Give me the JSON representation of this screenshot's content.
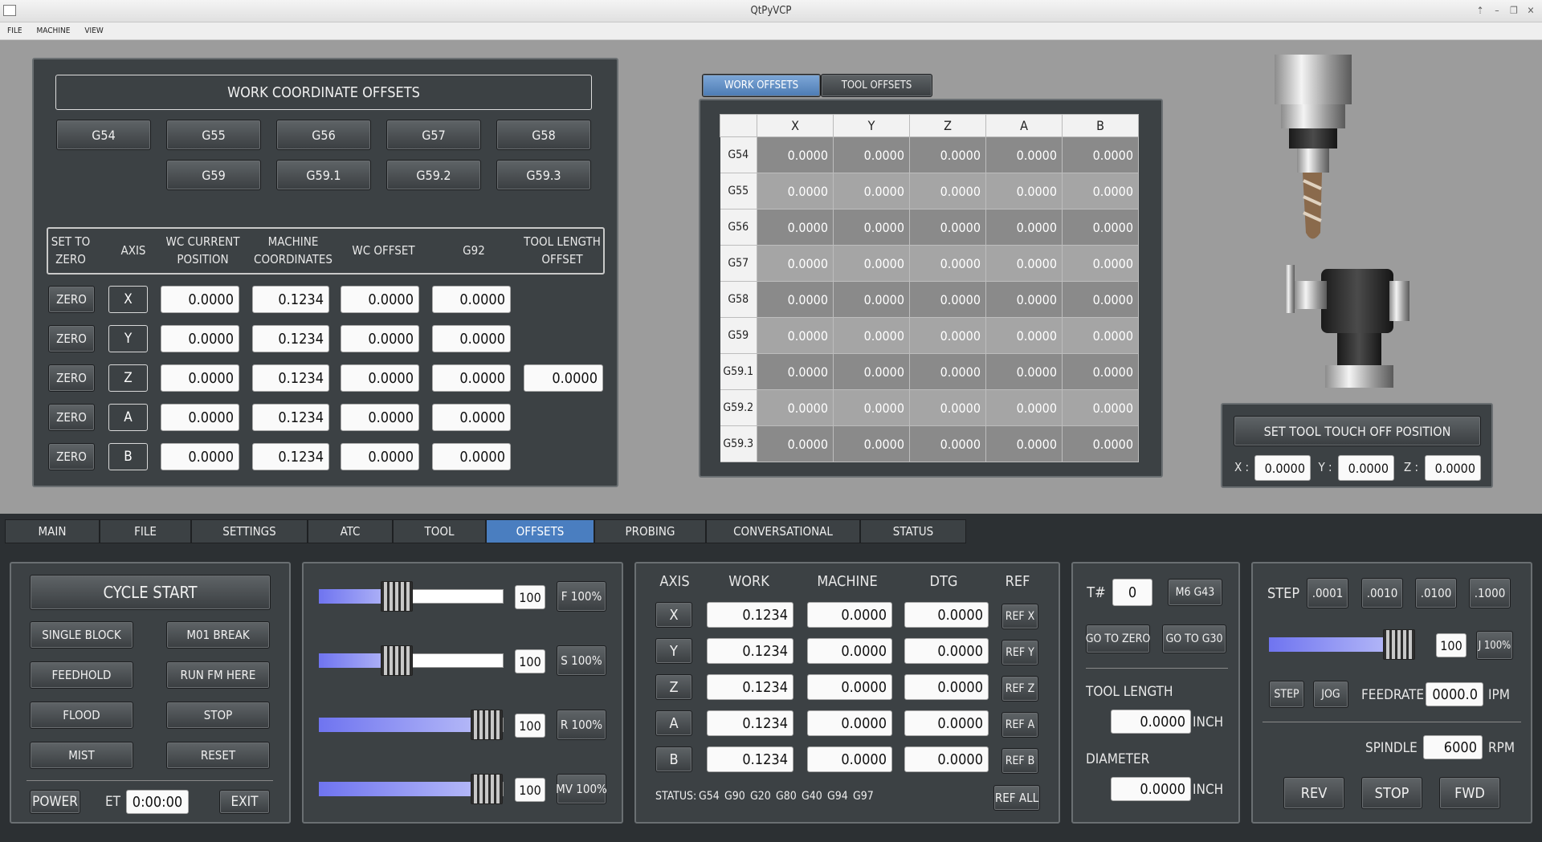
{
  "window": {
    "title": "QtPyVCP",
    "controls": [
      "⇡",
      "–",
      "❐",
      "✕"
    ]
  },
  "menu": [
    "FILE",
    "MACHINE",
    "VIEW"
  ],
  "wco": {
    "title": "WORK COORDINATE OFFSETS",
    "row1": [
      "G54",
      "G55",
      "G56",
      "G57",
      "G58"
    ],
    "row2": [
      "G59",
      "G59.1",
      "G59.2",
      "G59.3"
    ],
    "headers": [
      "SET TO\nZERO",
      "AXIS",
      "WC CURRENT\nPOSITION",
      "MACHINE\nCOORDINATES",
      "WC OFFSET",
      "G92",
      "TOOL LENGTH\nOFFSET"
    ],
    "zero_label": "ZERO",
    "rows": [
      {
        "axis": "X",
        "wc": "0.0000",
        "mach": "0.1234",
        "off": "0.0000",
        "g92": "0.0000"
      },
      {
        "axis": "Y",
        "wc": "0.0000",
        "mach": "0.1234",
        "off": "0.0000",
        "g92": "0.0000"
      },
      {
        "axis": "Z",
        "wc": "0.0000",
        "mach": "0.1234",
        "off": "0.0000",
        "g92": "0.0000",
        "tlo": "0.0000"
      },
      {
        "axis": "A",
        "wc": "0.0000",
        "mach": "0.1234",
        "off": "0.0000",
        "g92": "0.0000"
      },
      {
        "axis": "B",
        "wc": "0.0000",
        "mach": "0.1234",
        "off": "0.0000",
        "g92": "0.0000"
      }
    ]
  },
  "offset_tabs": [
    "WORK OFFSETS",
    "TOOL OFFSETS"
  ],
  "offset_table": {
    "columns": [
      "X",
      "Y",
      "Z",
      "A",
      "B"
    ],
    "rows": [
      {
        "name": "G54",
        "vals": [
          "0.0000",
          "0.0000",
          "0.0000",
          "0.0000",
          "0.0000"
        ]
      },
      {
        "name": "G55",
        "vals": [
          "0.0000",
          "0.0000",
          "0.0000",
          "0.0000",
          "0.0000"
        ]
      },
      {
        "name": "G56",
        "vals": [
          "0.0000",
          "0.0000",
          "0.0000",
          "0.0000",
          "0.0000"
        ]
      },
      {
        "name": "G57",
        "vals": [
          "0.0000",
          "0.0000",
          "0.0000",
          "0.0000",
          "0.0000"
        ]
      },
      {
        "name": "G58",
        "vals": [
          "0.0000",
          "0.0000",
          "0.0000",
          "0.0000",
          "0.0000"
        ]
      },
      {
        "name": "G59",
        "vals": [
          "0.0000",
          "0.0000",
          "0.0000",
          "0.0000",
          "0.0000"
        ]
      },
      {
        "name": "G59.1",
        "vals": [
          "0.0000",
          "0.0000",
          "0.0000",
          "0.0000",
          "0.0000"
        ]
      },
      {
        "name": "G59.2",
        "vals": [
          "0.0000",
          "0.0000",
          "0.0000",
          "0.0000",
          "0.0000"
        ]
      },
      {
        "name": "G59.3",
        "vals": [
          "0.0000",
          "0.0000",
          "0.0000",
          "0.0000",
          "0.0000"
        ]
      }
    ]
  },
  "touchoff": {
    "button": "SET TOOL TOUCH OFF POSITION",
    "x_label": "X :",
    "y_label": "Y :",
    "z_label": "Z :",
    "x": "0.0000",
    "y": "0.0000",
    "z": "0.0000"
  },
  "main_tabs": [
    "MAIN",
    "FILE",
    "SETTINGS",
    "ATC",
    "TOOL",
    "OFFSETS",
    "PROBING",
    "CONVERSATIONAL",
    "STATUS"
  ],
  "active_tab": "OFFSETS",
  "control": {
    "cycle_start": "CYCLE START",
    "single_block": "SINGLE BLOCK",
    "m01_break": "M01 BREAK",
    "feedhold": "FEEDHOLD",
    "run_from_here": "RUN FM HERE",
    "flood": "FLOOD",
    "stop": "STOP",
    "mist": "MIST",
    "reset": "RESET",
    "power": "POWER",
    "et_label": "ET",
    "et_value": "0:00:00",
    "exit": "EXIT"
  },
  "overrides": [
    {
      "value": "100",
      "button": "F 100%",
      "level": 0.42
    },
    {
      "value": "100",
      "button": "S 100%",
      "level": 0.42
    },
    {
      "value": "100",
      "button": "R 100%",
      "level": 0.91
    },
    {
      "value": "100",
      "button": "MV 100%",
      "level": 0.91
    }
  ],
  "dro": {
    "headers": [
      "AXIS",
      "WORK",
      "MACHINE",
      "DTG",
      "REF"
    ],
    "rows": [
      {
        "axis": "X",
        "work": "0.1234",
        "mach": "0.0000",
        "dtg": "0.0000",
        "ref": "REF X"
      },
      {
        "axis": "Y",
        "work": "0.1234",
        "mach": "0.0000",
        "dtg": "0.0000",
        "ref": "REF Y"
      },
      {
        "axis": "Z",
        "work": "0.1234",
        "mach": "0.0000",
        "dtg": "0.0000",
        "ref": "REF Z"
      },
      {
        "axis": "A",
        "work": "0.1234",
        "mach": "0.0000",
        "dtg": "0.0000",
        "ref": "REF A"
      },
      {
        "axis": "B",
        "work": "0.1234",
        "mach": "0.0000",
        "dtg": "0.0000",
        "ref": "REF B"
      }
    ],
    "status_label": "STATUS:",
    "status_codes": [
      "G54",
      "G90",
      "G20",
      "G80",
      "G40",
      "G94",
      "G97"
    ],
    "ref_all": "REF ALL"
  },
  "tool": {
    "t_label": "T#",
    "t_value": "0",
    "m6": "M6 G43",
    "go_zero": "GO TO ZERO",
    "go_g30": "GO TO G30",
    "length_label": "TOOL LENGTH",
    "length": "0.0000",
    "unit": "INCH",
    "diameter_label": "DIAMETER",
    "diameter": "0.0000"
  },
  "jog": {
    "step_label": "STEP",
    "steps": [
      ".0001",
      ".0010",
      ".0100",
      ".1000"
    ],
    "jog_value": "100",
    "jog_button": "J 100%",
    "jog_level": 0.9,
    "step_btn": "STEP",
    "jog_btn": "JOG",
    "feed_label": "FEEDRATE",
    "feed": "0000.0",
    "feed_unit": "IPM",
    "spindle_label": "SPINDLE",
    "spindle": "6000",
    "spindle_unit": "RPM",
    "rev": "REV",
    "stop": "STOP",
    "fwd": "FWD"
  },
  "colors": {
    "panel": "#3c4144",
    "accent": "#4a7ec0",
    "slider": "#6f74f0",
    "background": "#9c9c9c"
  }
}
